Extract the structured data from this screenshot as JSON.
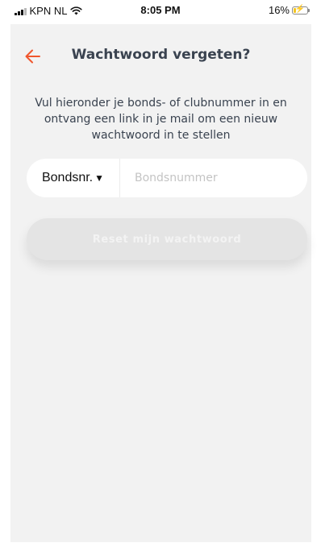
{
  "status_bar": {
    "carrier": "KPN NL",
    "time": "8:05 PM",
    "battery_percent": "16%",
    "battery_level": 0.16,
    "signal_icon": "signal-bars-icon",
    "wifi_icon": "wifi-icon",
    "battery_icon": "battery-charging-icon"
  },
  "header": {
    "title": "Wachtwoord vergeten?",
    "back_icon": "arrow-left-icon",
    "accent_color": "#f0562d"
  },
  "instructions": "Vul hieronder je bonds- of clubnummer in en ontvang een link in je mail om een nieuw wachtwoord in te stellen",
  "form": {
    "id_type_selected": "Bondsnr.",
    "id_type_caret": "▼",
    "number_placeholder": "Bondsnummer",
    "number_value": "",
    "submit_label": "Reset mijn wachtwoord"
  }
}
